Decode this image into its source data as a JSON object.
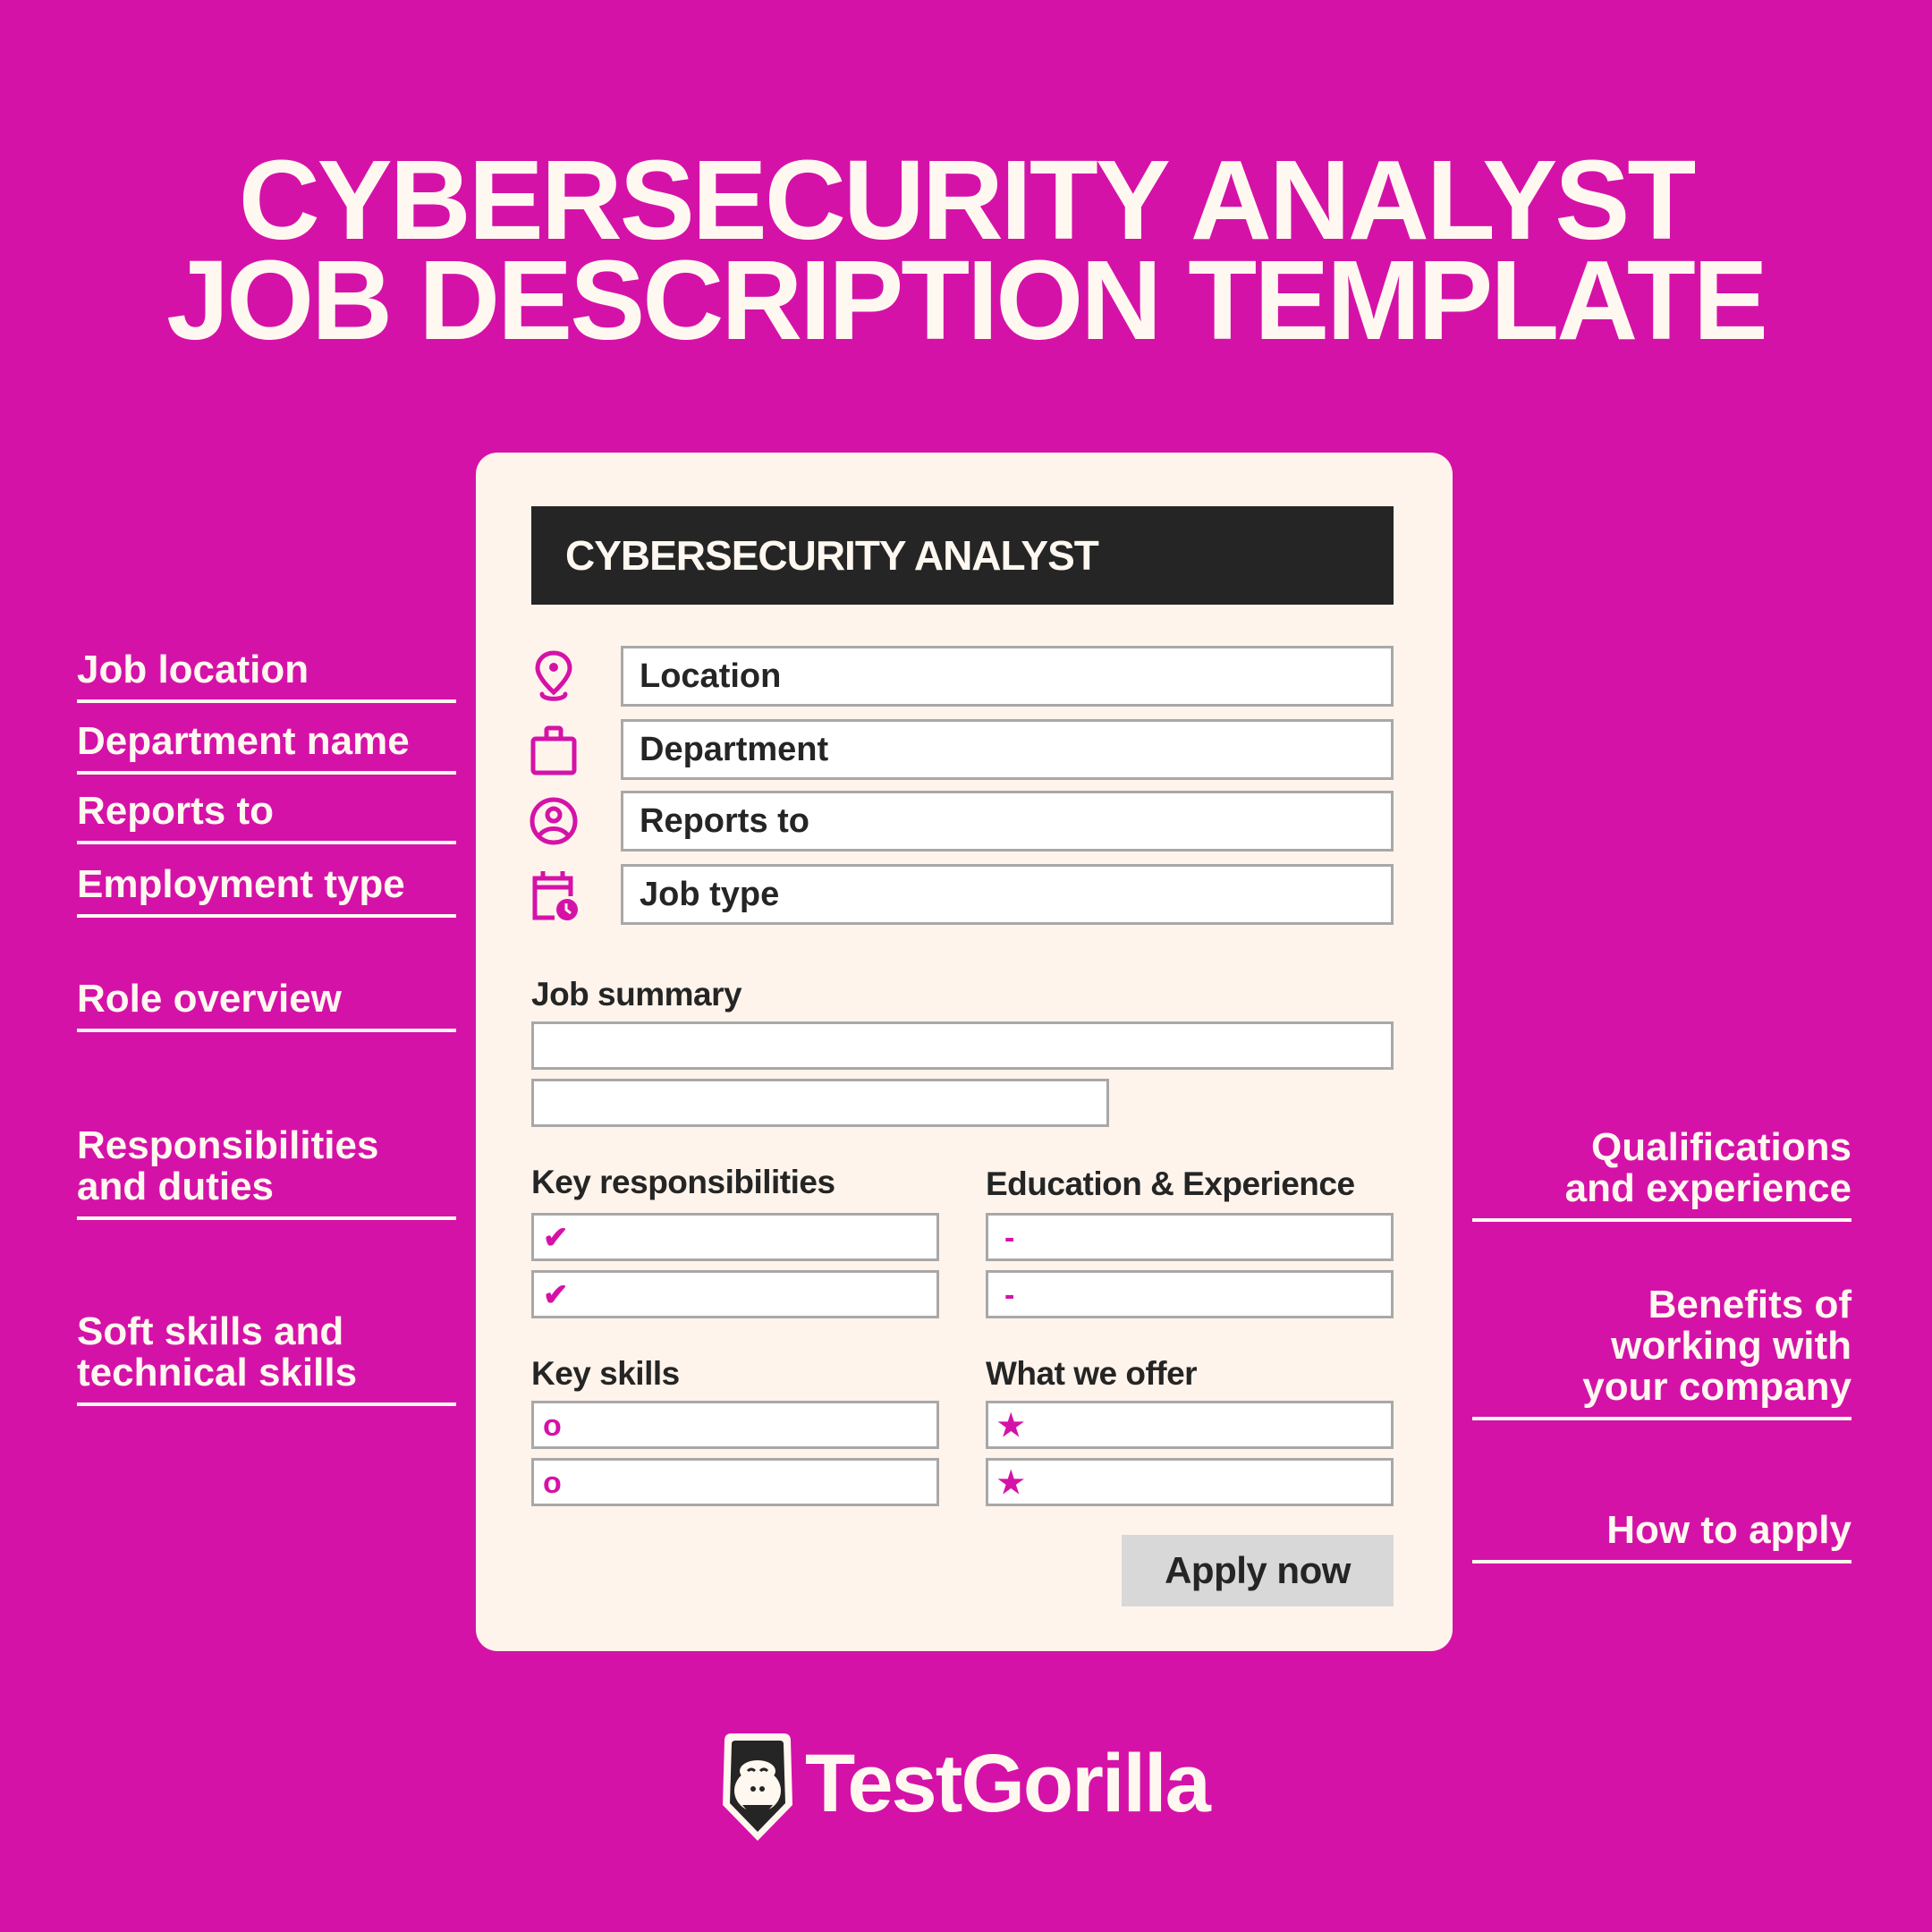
{
  "page": {
    "title_line1": "CYBERSECURITY ANALYST",
    "title_line2": "JOB DESCRIPTION TEMPLATE",
    "colors": {
      "background": "#d512a8",
      "card": "#fff4ec",
      "header": "#252525",
      "accent": "#d512a8",
      "border": "#a8a8a8",
      "button": "#d8d8d8"
    }
  },
  "annotations_left": [
    {
      "label": "Job location"
    },
    {
      "label": "Department name"
    },
    {
      "label": "Reports to"
    },
    {
      "label": "Employment type"
    },
    {
      "label": "Role overview"
    },
    {
      "line1": "Responsibilities",
      "line2": "and duties"
    },
    {
      "line1": "Soft skills and",
      "line2": "technical skills"
    }
  ],
  "annotations_right": [
    {
      "line1": "Qualifications",
      "line2": "and experience"
    },
    {
      "line1": "Benefits of",
      "line2": "working with",
      "line3": "your company"
    },
    {
      "label": "How to apply"
    }
  ],
  "card": {
    "header": "CYBERSECURITY ANALYST",
    "fields": [
      {
        "icon": "location-pin-icon",
        "value": "Location"
      },
      {
        "icon": "briefcase-icon",
        "value": "Department"
      },
      {
        "icon": "user-circle-icon",
        "value": "Reports to"
      },
      {
        "icon": "calendar-clock-icon",
        "value": "Job type"
      }
    ],
    "job_summary_label": "Job summary",
    "key_responsibilities": {
      "label": "Key responsibilities",
      "bullet": "✔",
      "bullet_icon": "checkmark-icon"
    },
    "education_experience": {
      "label": "Education & Experience",
      "bullet": "-",
      "bullet_icon": "dash-icon"
    },
    "key_skills": {
      "label": "Key skills",
      "bullet": "o",
      "bullet_icon": "ring-icon"
    },
    "what_we_offer": {
      "label": "What we offer",
      "bullet": "★",
      "bullet_icon": "star-icon"
    },
    "apply_button": "Apply now"
  },
  "brand": {
    "name": "TestGorilla",
    "logo_icon": "gorilla-logo-icon"
  }
}
